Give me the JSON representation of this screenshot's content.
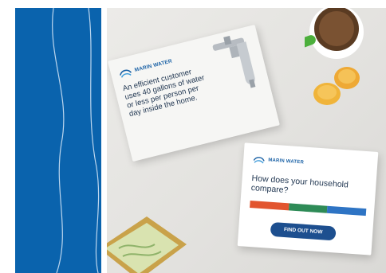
{
  "brand": {
    "name": "MARIN WATER",
    "color": "#0a63ad"
  },
  "card1": {
    "message": "An efficient customer uses 40 gallons of water or less per person per day inside the home."
  },
  "card2": {
    "question": "How does your household compare?",
    "button_label": "FIND OUT NOW",
    "bar_colors": [
      "#e2552f",
      "#2e8b57",
      "#2e74c4"
    ]
  },
  "icons": [
    "marin-water-logo-icon",
    "faucet-icon",
    "coffee-mug-icon",
    "cookie-icon"
  ]
}
